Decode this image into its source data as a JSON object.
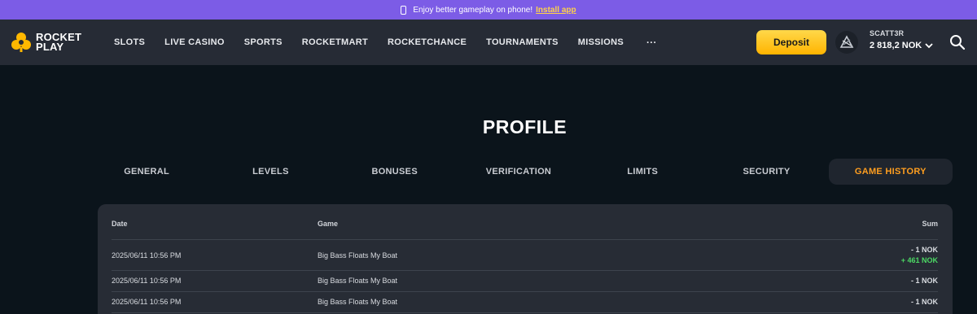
{
  "promo": {
    "text": "Enjoy better gameplay on phone!",
    "link": "Install app",
    "icon": "phone-icon"
  },
  "header": {
    "logo_line1": "ROCKET",
    "logo_line2": "PLAY",
    "nav": [
      "SLOTS",
      "LIVE CASINO",
      "SPORTS",
      "ROCKETMART",
      "ROCKETCHANCE",
      "TOURNAMENTS",
      "MISSIONS"
    ],
    "more": "···",
    "deposit": "Deposit",
    "username": "SCATT3R",
    "balance": "2 818,2 NOK"
  },
  "page": {
    "title": "PROFILE",
    "tabs": [
      "GENERAL",
      "LEVELS",
      "BONUSES",
      "VERIFICATION",
      "LIMITS",
      "SECURITY",
      "GAME HISTORY"
    ],
    "active_tab": "GAME HISTORY"
  },
  "history": {
    "columns": {
      "date": "Date",
      "game": "Game",
      "sum": "Sum"
    },
    "rows": [
      {
        "date": "2025/06/11 10:56 PM",
        "game": "Big Bass Floats My Boat",
        "bet": "- 1 NOK",
        "win": "+ 461 NOK"
      },
      {
        "date": "2025/06/11 10:56 PM",
        "game": "Big Bass Floats My Boat",
        "bet": "- 1 NOK"
      },
      {
        "date": "2025/06/11 10:56 PM",
        "game": "Big Bass Floats My Boat",
        "bet": "- 1 NOK"
      }
    ]
  },
  "colors": {
    "banner": "#7c5ce6",
    "header_bg": "#262b35",
    "page_bg": "#0b141b",
    "accent": "#ff9e1f",
    "deposit": "#ffc21a",
    "win": "#4cd964"
  }
}
